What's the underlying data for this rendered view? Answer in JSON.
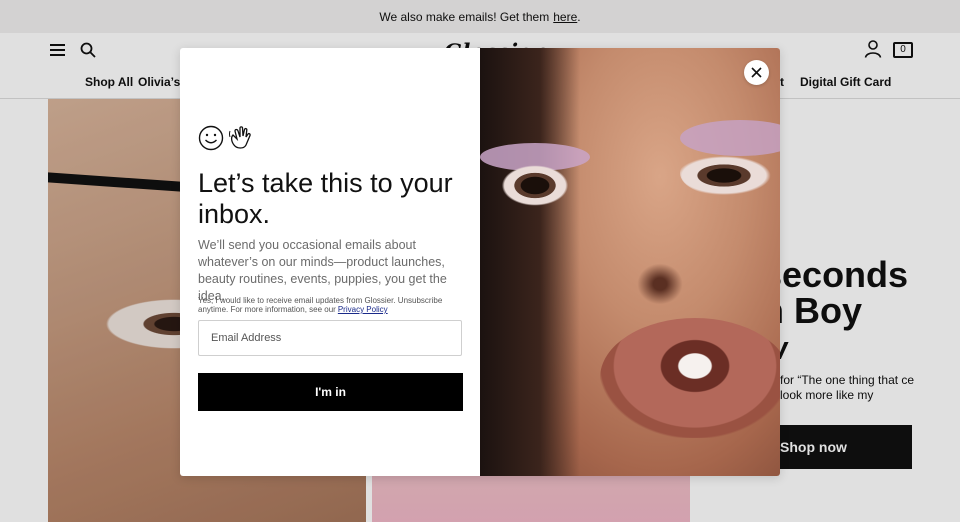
{
  "announcement": {
    "text": "We also make emails! Get them",
    "link": "here",
    "punct": "."
  },
  "header": {
    "logo": "Glossier",
    "bag_count": "0",
    "nav": [
      "Shop All",
      "Olivia’s F",
      "t",
      "Digital Gift Card"
    ]
  },
  "hero": {
    "title_line1": "seconds",
    "title_line2": "n Boy",
    "title_line3": "w",
    "subtitle": "for “The one thing that ce look more like my",
    "cta": "Shop now"
  },
  "modal": {
    "emoji": "☺👋",
    "title": "Let’s take this to your inbox.",
    "body": "We’ll send you occasional emails about whatever’s on our minds—product launches, beauty routines, events, puppies, you get the idea.",
    "consent": "Yes, I would like to receive email updates from Glossier. Unsubscribe anytime. For more information, see our",
    "privacy_link": "Privacy Policy",
    "email_placeholder": "Email Address",
    "submit_label": "I'm in"
  },
  "colors": {
    "accent": "#000000",
    "announce_bg": "#f1f0ef",
    "link": "#1a2a8a"
  }
}
